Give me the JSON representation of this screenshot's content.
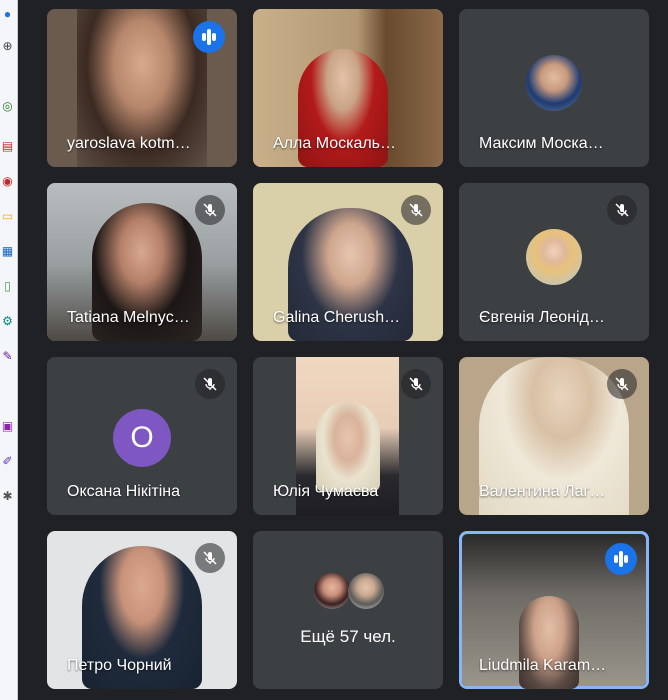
{
  "tiles": [
    {
      "name": "yaroslava kotm…",
      "status": "speaking"
    },
    {
      "name": "Алла Москаль…",
      "status": "none"
    },
    {
      "name": "Максим Моска…",
      "status": "none"
    },
    {
      "name": "Tatiana Melnyc…",
      "status": "muted"
    },
    {
      "name": "Galina Cherush…",
      "status": "muted"
    },
    {
      "name": "Євгенія Леонід…",
      "status": "muted"
    },
    {
      "name": "Оксана Нікітіна",
      "status": "muted",
      "avatar_letter": "О",
      "avatar_color": "#7e57c2"
    },
    {
      "name": "Юлія Чумаєва",
      "status": "muted"
    },
    {
      "name": "Валентина Лаг…",
      "status": "muted"
    },
    {
      "name": "Петро Чорний",
      "status": "muted"
    },
    {
      "more_label": "Ещё 57 чел."
    },
    {
      "name": "Liudmila Karam…",
      "status": "speaking",
      "highlighted": true
    }
  ],
  "icons": {
    "sidebar": [
      "browser-icon",
      "zoom-icon",
      "share-icon",
      "layout-icon",
      "record-icon",
      "chat-icon",
      "apps-icon",
      "panel-icon",
      "settings-icon",
      "pen-icon",
      "file-icon",
      "edit-icon",
      "plugin-icon"
    ],
    "mute": "mic-off-icon",
    "speaking": "audio-level-icon"
  },
  "colors": {
    "background": "#202124",
    "tile": "#3c4043",
    "speaking": "#1a73e8",
    "highlight": "#8ab4f8"
  }
}
